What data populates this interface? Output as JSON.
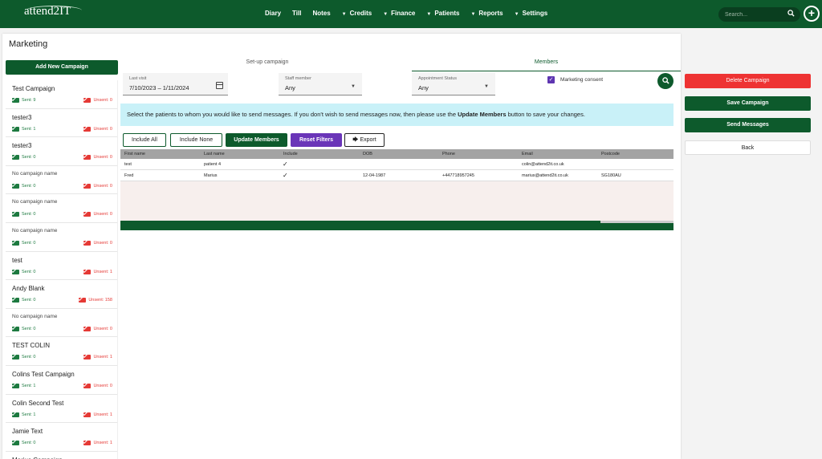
{
  "brand": {
    "logo_text": "attend2IT"
  },
  "nav": {
    "items": [
      {
        "label": "Diary",
        "caret": false
      },
      {
        "label": "Till",
        "caret": false
      },
      {
        "label": "Notes",
        "caret": false
      },
      {
        "label": "Credits",
        "caret": true
      },
      {
        "label": "Finance",
        "caret": true
      },
      {
        "label": "Patients",
        "caret": true
      },
      {
        "label": "Reports",
        "caret": true
      },
      {
        "label": "Settings",
        "caret": true
      }
    ],
    "search_placeholder": "Search..."
  },
  "page": {
    "title": "Marketing"
  },
  "left": {
    "add_label": "Add New Campaign",
    "campaigns": [
      {
        "name": "Test Campaign",
        "sent": "Sent: 9",
        "unsent": "Unsent: 0"
      },
      {
        "name": "tester3",
        "sent": "Sent: 1",
        "unsent": "Unsent: 0"
      },
      {
        "name": "tester3",
        "sent": "Sent: 0",
        "unsent": "Unsent: 0"
      },
      {
        "name": "No campaign name",
        "sent": "Sent: 0",
        "unsent": "Unsent: 0"
      },
      {
        "name": "No campaign name",
        "sent": "Sent: 0",
        "unsent": "Unsent: 0"
      },
      {
        "name": "No campaign name",
        "sent": "Sent: 0",
        "unsent": "Unsent: 0"
      },
      {
        "name": "test",
        "sent": "Sent: 0",
        "unsent": "Unsent: 1"
      },
      {
        "name": "Andy Blank",
        "sent": "Sent: 0",
        "unsent": "Unsent: 158"
      },
      {
        "name": "No campaign name",
        "sent": "Sent: 0",
        "unsent": "Unsent: 0"
      },
      {
        "name": "TEST COLIN",
        "sent": "Sent: 0",
        "unsent": "Unsent: 1"
      },
      {
        "name": "Colins Test Campaign",
        "sent": "Sent: 1",
        "unsent": "Unsent: 0"
      },
      {
        "name": "Colin Second Test",
        "sent": "Sent: 1",
        "unsent": "Unsent: 1"
      },
      {
        "name": "Jamie Text",
        "sent": "Sent: 0",
        "unsent": "Unsent: 1"
      },
      {
        "name": "Marius Campaign",
        "sent": "",
        "unsent": ""
      }
    ]
  },
  "tabs": {
    "setup": "Set-up campaign",
    "members": "Members"
  },
  "filters": {
    "last_visit_label": "Last visit",
    "last_visit_value": "7/10/2023 – 1/11/2024",
    "staff_label": "Staff member",
    "staff_value": "Any",
    "appt_label": "Appointment Status",
    "appt_value": "Any",
    "consent_label": "Marketing consent",
    "consent_checked": true
  },
  "info": {
    "before": "Select the patients to whom you would like to send messages. If you don't wish to send messages now, then please use the ",
    "bold": "Update Members",
    "after": " button to save your changes."
  },
  "actions": {
    "include_all": "Include All",
    "include_none": "Include None",
    "update_members": "Update Members",
    "reset_filters": "Reset Filters",
    "export": "Export"
  },
  "table": {
    "headers": [
      "First name",
      "Last name",
      "Include",
      "DOB",
      "Phone",
      "Email",
      "Postcode"
    ],
    "rows": [
      {
        "first": "test",
        "last": "patient 4",
        "include": "✓",
        "dob": "",
        "phone": "",
        "email": "colin@attend2it.co.uk",
        "postcode": ""
      },
      {
        "first": "Fred",
        "last": "Marius",
        "include": "✓",
        "dob": "12-04-1987",
        "phone": "+447718957245",
        "email": "marius@attend2it.co.uk",
        "postcode": "SG180AU"
      }
    ]
  },
  "right": {
    "delete": "Delete Campaign",
    "save": "Save Campaign",
    "send": "Send Messages",
    "back": "Back"
  },
  "colors": {
    "brand_green": "#0d5a2c",
    "danger_red": "#ee3333",
    "purple": "#6a35b8",
    "info_blue": "#c9f1f8"
  }
}
